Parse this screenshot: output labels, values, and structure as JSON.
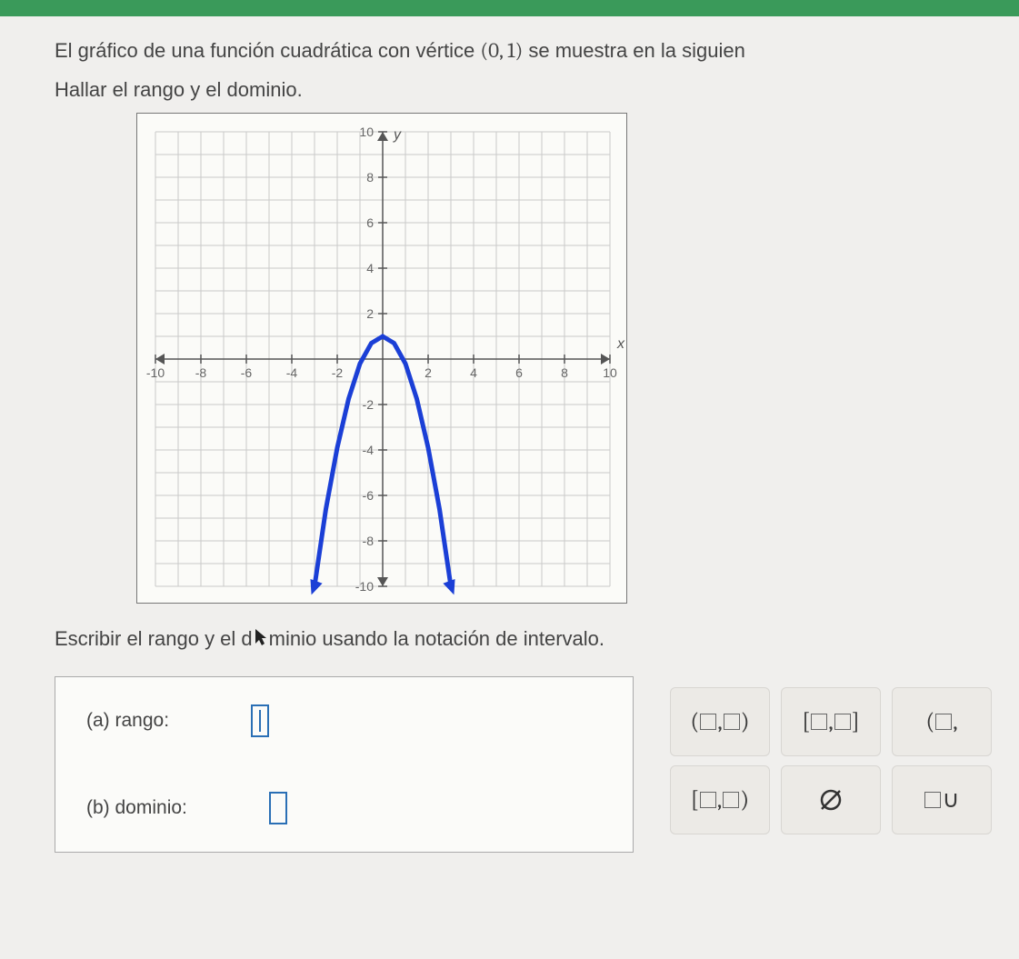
{
  "problem": {
    "line1_pre": "El gráfico de una función cuadrática con vértice ",
    "vertex": "(0, 1)",
    "line1_post": " se muestra en la siguien",
    "line2": "Hallar el rango y el dominio."
  },
  "instruction_pre": "Escribir el rango y el d",
  "instruction_post": "minio usando la notación de intervalo.",
  "answers": {
    "a_label": "(a)  rango:",
    "b_label": "(b)  dominio:"
  },
  "palette": {
    "open_open": "(□,□)",
    "closed_closed": "[□,□]",
    "open_half": "(□,",
    "closed_open": "[□,□)",
    "empty": "∅",
    "union": "□∪"
  },
  "chart_data": {
    "type": "line",
    "title": "",
    "xlabel": "x",
    "ylabel": "y",
    "xlim": [
      -10,
      10
    ],
    "ylim": [
      -10,
      10
    ],
    "x_ticks": [
      -10,
      -8,
      -6,
      -4,
      -2,
      2,
      4,
      6,
      8,
      10
    ],
    "y_ticks": [
      -10,
      -8,
      -6,
      -4,
      -2,
      2,
      4,
      6,
      8,
      10
    ],
    "grid": true,
    "series": [
      {
        "name": "parabola",
        "vertex": [
          0,
          1
        ],
        "opens": "down",
        "x": [
          -3,
          -2.5,
          -2,
          -1.5,
          -1,
          -0.5,
          0,
          0.5,
          1,
          1.5,
          2,
          2.5,
          3
        ],
        "y": [
          -10,
          -6.6,
          -3.9,
          -1.75,
          -0.2,
          0.7,
          1,
          0.7,
          -0.2,
          -1.75,
          -3.9,
          -6.6,
          -10
        ]
      }
    ],
    "annotations": []
  }
}
